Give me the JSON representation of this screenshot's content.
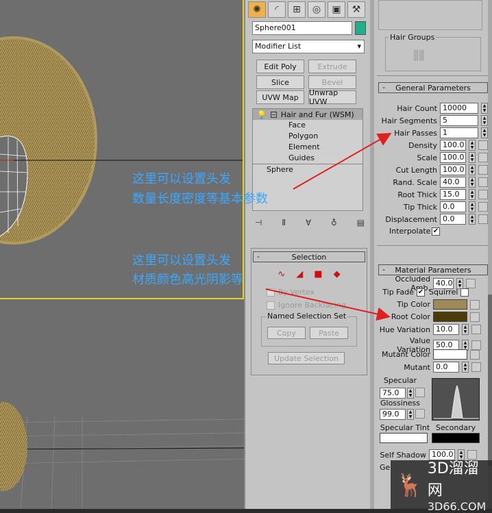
{
  "tabs": [
    "create-icon",
    "modify-icon",
    "hierarchy-icon",
    "motion-icon",
    "display-icon",
    "utilities-icon"
  ],
  "object_name": "Sphere001",
  "object_color": "#1fb08a",
  "modifier_list": "Modifier List",
  "buttons": {
    "edit_poly": "Edit Poly",
    "extrude": "Extrude",
    "slice": "Slice",
    "bevel": "Bevel",
    "uvw_map": "UVW Map",
    "unwrap_uvw": "Unwrap UVW"
  },
  "stack": {
    "modifier": "Hair and Fur (WSM)",
    "subs": [
      "Face",
      "Polygon",
      "Element",
      "Guides"
    ],
    "base": "Sphere"
  },
  "selection": {
    "title": "Selection",
    "by_vertex": "By Vertex",
    "ignore_backfacing": "Ignore Backfacing",
    "named_set": "Named Selection Set",
    "copy": "Copy",
    "paste": "Paste",
    "update": "Update Selection"
  },
  "hair_groups_label": "Hair Groups",
  "general": {
    "title": "General Parameters",
    "params": [
      {
        "label": "Hair Count",
        "value": "10000"
      },
      {
        "label": "Hair Segments",
        "value": "5"
      },
      {
        "label": "Hair Passes",
        "value": "1"
      },
      {
        "label": "Density",
        "value": "100.0"
      },
      {
        "label": "Scale",
        "value": "100.0"
      },
      {
        "label": "Cut Length",
        "value": "100.0"
      },
      {
        "label": "Rand. Scale",
        "value": "40.0"
      },
      {
        "label": "Root Thick",
        "value": "15.0"
      },
      {
        "label": "Tip Thick",
        "value": "0.0"
      },
      {
        "label": "Displacement",
        "value": "0.0"
      }
    ],
    "interpolate": "Interpolate"
  },
  "material": {
    "title": "Material Parameters",
    "occluded": {
      "label": "Occluded Amb.",
      "value": "40.0"
    },
    "tip_fade": "Tip Fade",
    "squirrel": "Squirrel",
    "tip_color": {
      "label": "Tip Color",
      "color": "#9d8a58"
    },
    "root_color": {
      "label": "Root Color",
      "color": "#4e3c08"
    },
    "hue_var": {
      "label": "Hue Variation",
      "value": "10.0"
    },
    "value_var": {
      "label": "Value Variation",
      "value": "50.0"
    },
    "mutant_color": {
      "label": "Mutant Color",
      "color": "#ffffff"
    },
    "mutant": {
      "label": "Mutant",
      "value": "0.0"
    },
    "specular": {
      "label": "Specular",
      "value": "75.0"
    },
    "glossiness": {
      "label": "Glossiness",
      "value": "99.0"
    },
    "spec_tint": {
      "label": "Specular Tint",
      "color": "#ffffff"
    },
    "secondary": {
      "label": "Secondary",
      "color": "#000000"
    },
    "self_shadow": {
      "label": "Self Shadow",
      "value": "100.0"
    },
    "geo_partial": "Ge"
  },
  "annotations": {
    "a1_line1": "这里可以设置头发",
    "a1_line2": "数量长度密度等基本参数",
    "a2_line1": "这里可以设置头发",
    "a2_line2": "材质颜色高光阴影等"
  },
  "watermark": {
    "brand": "3D溜溜网",
    "url": "3D66.COM"
  }
}
